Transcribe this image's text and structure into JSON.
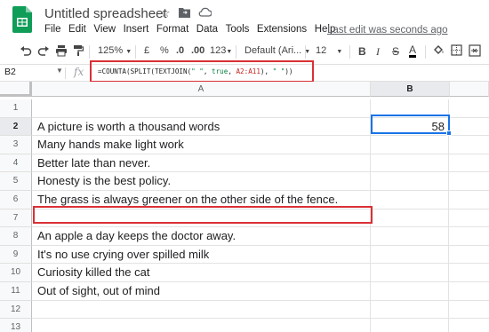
{
  "header": {
    "doc_title": "Untitled spreadsheet",
    "last_edit": "Last edit was seconds ago",
    "menu": [
      "File",
      "Edit",
      "View",
      "Insert",
      "Format",
      "Data",
      "Tools",
      "Extensions",
      "Help"
    ]
  },
  "toolbar": {
    "zoom": "125%",
    "currency": "£",
    "percent": "%",
    "decrease_decimal": ".0",
    "increase_decimal": ".00",
    "more_formats": "123",
    "font": "Default (Ari...",
    "font_size": "12",
    "bold": "B",
    "italic": "I",
    "strike": "S",
    "text_color": "A"
  },
  "formula_bar": {
    "name_box": "B2",
    "fx": "fx",
    "formula_parts": {
      "p1": "=COUNTA(SPLIT(TEXTJOIN(",
      "s1": "\" \"",
      "p2": ", ",
      "b1": "true",
      "p3": ", ",
      "r1": "A2:A11",
      "p4": "), ",
      "s2": "\" \"",
      "p5": "))"
    }
  },
  "grid": {
    "columns": [
      "A",
      "B"
    ],
    "selected_column": "B",
    "selected_cell": "B2",
    "rows": [
      {
        "num": "1",
        "a": "",
        "b": ""
      },
      {
        "num": "2",
        "a": "A picture is worth a thousand words",
        "b": "58"
      },
      {
        "num": "3",
        "a": "Many hands make light work",
        "b": ""
      },
      {
        "num": "4",
        "a": "Better late than never.",
        "b": ""
      },
      {
        "num": "5",
        "a": "Honesty is the best policy.",
        "b": ""
      },
      {
        "num": "6",
        "a": "The grass is always greener on the other side of the fence.",
        "b": ""
      },
      {
        "num": "7",
        "a": "",
        "b": ""
      },
      {
        "num": "8",
        "a": "An apple a day keeps the doctor away.",
        "b": ""
      },
      {
        "num": "9",
        "a": "It's no use crying over spilled milk",
        "b": ""
      },
      {
        "num": "10",
        "a": "Curiosity killed the cat",
        "b": ""
      },
      {
        "num": "11",
        "a": "Out of sight, out of mind",
        "b": ""
      },
      {
        "num": "12",
        "a": "",
        "b": ""
      },
      {
        "num": "13",
        "a": "",
        "b": ""
      }
    ]
  },
  "colors": {
    "sheets_green": "#0f9d58",
    "selection_blue": "#1a73e8",
    "highlight_red": "#d93036"
  }
}
